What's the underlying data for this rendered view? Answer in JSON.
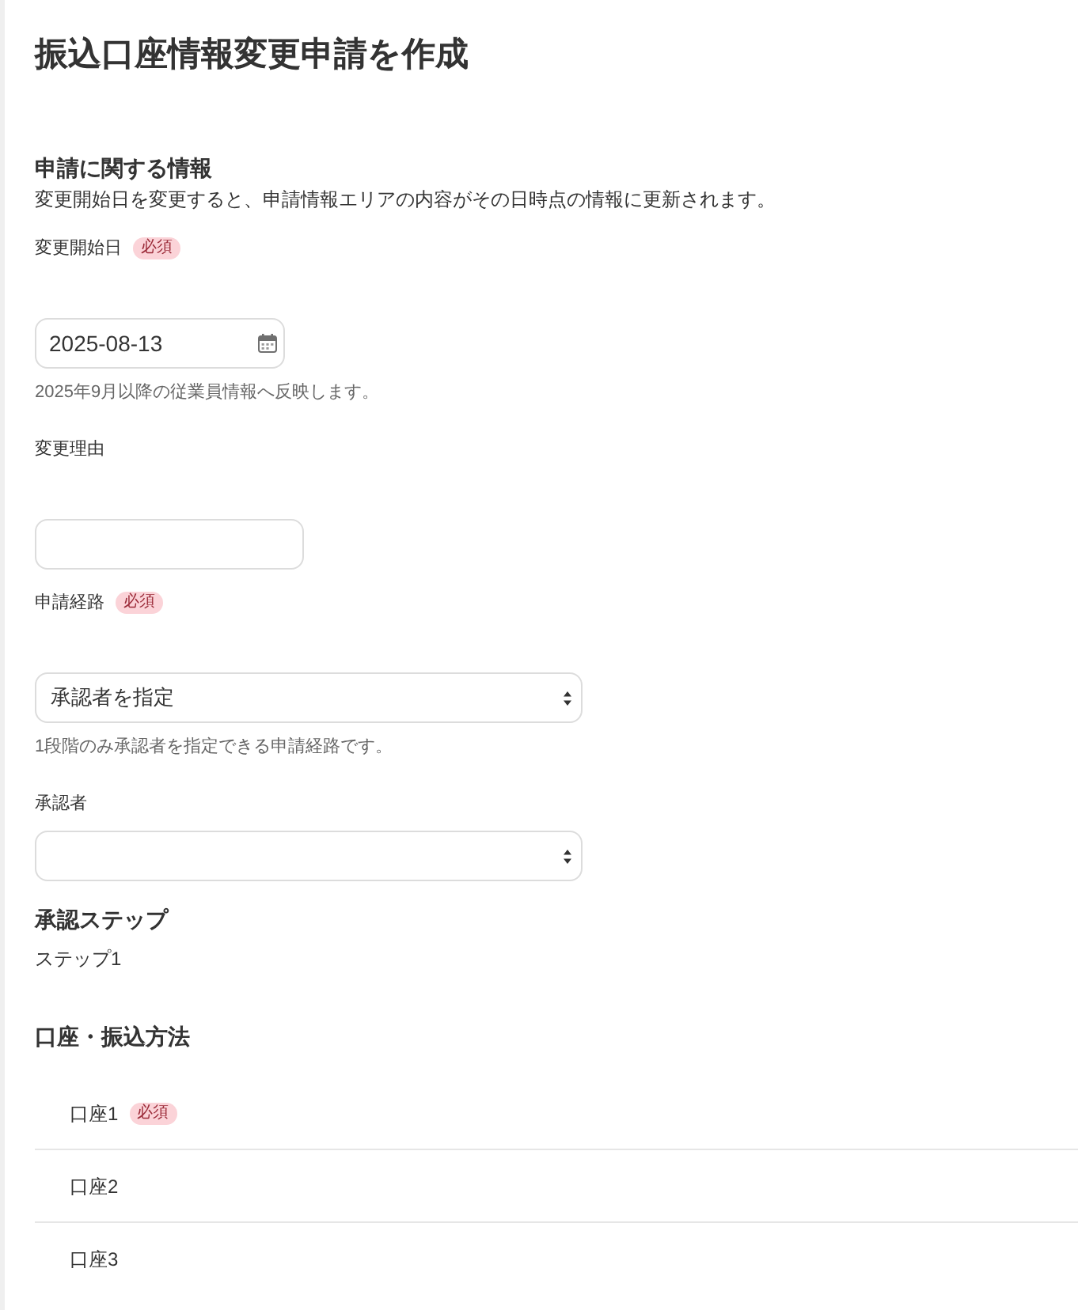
{
  "page": {
    "title": "振込口座情報変更申請を作成"
  },
  "application_info": {
    "heading": "申請に関する情報",
    "description": "変更開始日を変更すると、申請情報エリアの内容がその日時点の情報に更新されます。",
    "fields": [
      {
        "kind": "date",
        "label": "変更開始日",
        "badge": "必須",
        "value": "2025-08-13",
        "help": "2025年9月以降の従業員情報へ反映します。"
      },
      {
        "kind": "text",
        "label": "変更理由"
      },
      {
        "kind": "select",
        "label": "申請経路",
        "badge": "必須",
        "value": "承認者を指定",
        "help": "1段階のみ承認者を指定できる申請経路です。"
      },
      {
        "kind": "select",
        "label": "承認者"
      }
    ]
  },
  "approval_steps": {
    "heading": "承認ステップ",
    "steps": [
      "ステップ1"
    ]
  },
  "accounts": {
    "heading": "口座・振込方法",
    "items": [
      {
        "label": "口座1",
        "badge": "必須"
      },
      {
        "label": "口座2"
      },
      {
        "label": "口座3"
      }
    ]
  }
}
